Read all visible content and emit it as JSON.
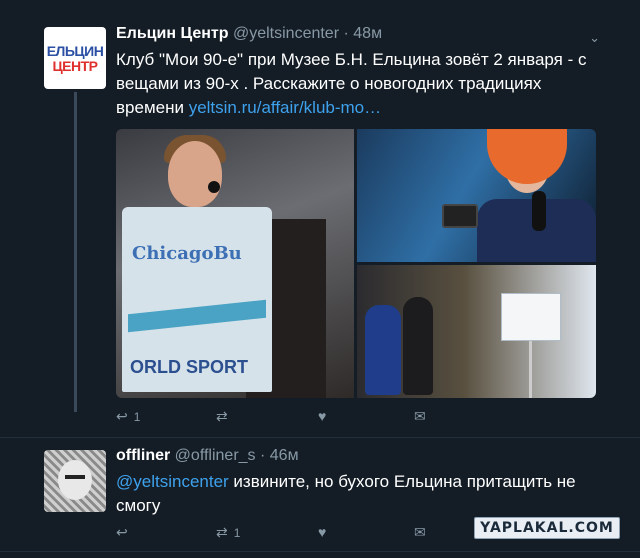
{
  "tweet1": {
    "avatar": {
      "line1": "ЕЛЬЦИН",
      "line2": "ЦЕНТР"
    },
    "name": "Ельцин Центр",
    "handle": "@yeltsincenter",
    "separator": "·",
    "time": "48м",
    "text": "Клуб \"Мои 90-е\" при Музее Б.Н. Ельцина зовёт 2 января - с вещами из 90-х . Расскажите о новогодних традициях времени ",
    "link": "yeltsin.ru/affair/klub-mo…",
    "media": {
      "shirt_text_1": "ChicagoBu",
      "shirt_text_2": "ORLD SPORT"
    },
    "actions": {
      "reply_count": "1",
      "retweet_count": "",
      "like_count": ""
    }
  },
  "tweet2": {
    "name": "offliner",
    "handle": "@offliner_s",
    "separator": "·",
    "time": "46м",
    "mention": "@yeltsincenter",
    "text": " извините, но бухого Ельцина притащить не смогу",
    "actions": {
      "reply_count": "",
      "retweet_count": "1",
      "like_count": ""
    }
  },
  "icons": {
    "reply": "↩",
    "retweet": "⇄",
    "like": "♥",
    "dm": "✉",
    "caret": "⌄"
  },
  "watermark": "YAPLAKAL.COM",
  "colors": {
    "background": "#141d26",
    "link": "#3ea1ec",
    "muted": "#8899a6"
  }
}
